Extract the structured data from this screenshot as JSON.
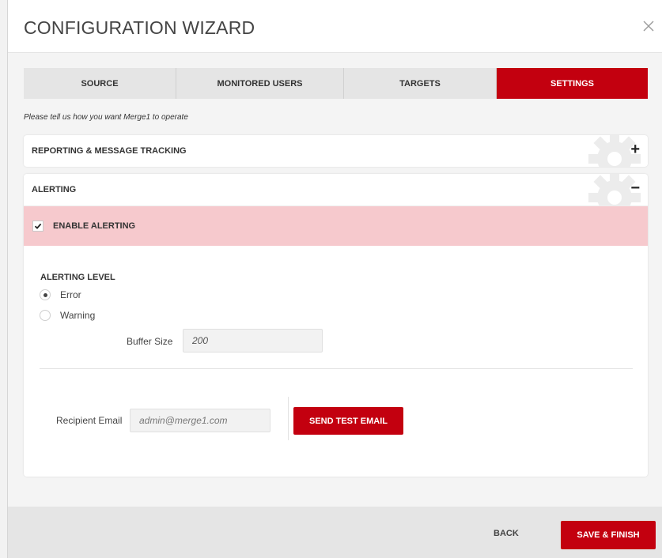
{
  "dialog": {
    "title": "CONFIGURATION WIZARD",
    "close_icon": "close-icon"
  },
  "tabs": [
    {
      "label": "SOURCE",
      "active": false
    },
    {
      "label": "MONITORED USERS",
      "active": false
    },
    {
      "label": "TARGETS",
      "active": false
    },
    {
      "label": "SETTINGS",
      "active": true
    }
  ],
  "subtitle": "Please tell us how you want Merge1 to operate",
  "panels": {
    "reporting": {
      "title": "REPORTING & MESSAGE TRACKING",
      "toggle": "+",
      "expanded": false
    },
    "alerting": {
      "title": "ALERTING",
      "toggle": "−",
      "expanded": true
    }
  },
  "alerting": {
    "enable_label": "ENABLE ALERTING",
    "enable_checked": true,
    "level_label": "ALERTING LEVEL",
    "levels": [
      {
        "label": "Error",
        "selected": true
      },
      {
        "label": "Warning",
        "selected": false
      }
    ],
    "buffer_label": "Buffer Size",
    "buffer_value": "200",
    "recipient_label": "Recipient Email",
    "recipient_placeholder": "admin@merge1.com",
    "test_button": "SEND TEST EMAIL"
  },
  "footer": {
    "back_label": "BACK",
    "finish_label": "SAVE & FINISH"
  },
  "colors": {
    "accent": "#c3000f",
    "highlight_row": "#f6c9cd",
    "tab_inactive": "#e5e5e5"
  }
}
